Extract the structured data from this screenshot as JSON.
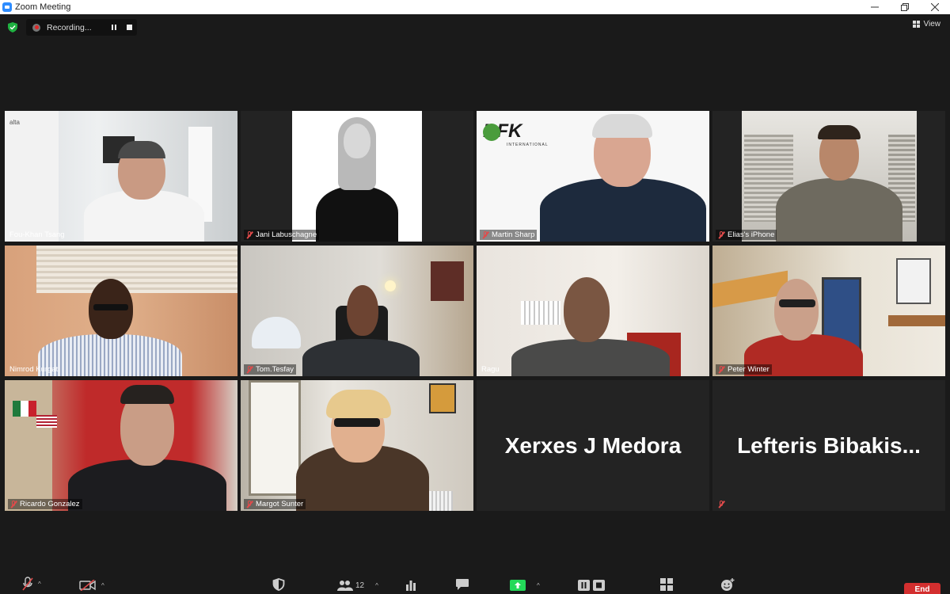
{
  "window": {
    "title": "Zoom Meeting",
    "controls": [
      "minimize",
      "restore",
      "close"
    ]
  },
  "top_bar": {
    "security_icon": "shield-check-icon",
    "recording_label": "Recording...",
    "view_label": "View"
  },
  "tiles": [
    {
      "name": "Fou-Khan Tsang",
      "muted": false,
      "active": false,
      "video": true
    },
    {
      "name": "Jani Labuschagne",
      "muted": true,
      "active": false,
      "video": true
    },
    {
      "name": "Martin Sharp",
      "muted": true,
      "active": false,
      "video": true,
      "logo_text": "DFK",
      "logo_sub": "INTERNATIONAL"
    },
    {
      "name": "Elias's iPhone",
      "muted": true,
      "active": false,
      "video": true
    },
    {
      "name": "Nimrod Kurgat",
      "muted": false,
      "active": true,
      "video": true
    },
    {
      "name": "Tom.Tesfay",
      "muted": true,
      "active": false,
      "video": true
    },
    {
      "name": "Ragu",
      "muted": false,
      "active": false,
      "video": true
    },
    {
      "name": "Peter Winter",
      "muted": true,
      "active": false,
      "video": true
    },
    {
      "name": "Ricardo Gonzalez",
      "muted": true,
      "active": false,
      "video": true
    },
    {
      "name": "Margot Sunter",
      "muted": true,
      "active": false,
      "video": true
    },
    {
      "name": "Xerxes J Medora",
      "muted": false,
      "active": false,
      "video": false
    },
    {
      "name": "Lefteris  Bibakis...",
      "muted": true,
      "active": false,
      "video": false
    }
  ],
  "toolbar": {
    "participants_count": "12",
    "end_label": "End",
    "items": [
      "mute-icon",
      "stop-video-icon",
      "security-icon",
      "participants-icon",
      "polls-icon",
      "chat-icon",
      "share-screen-icon",
      "record-icon",
      "breakout-rooms-icon",
      "reactions-icon"
    ]
  },
  "colors": {
    "active_speaker": "#d5e35a",
    "end_button": "#d32f2f",
    "share_green": "#23d959",
    "muted_red": "#e04b4b"
  }
}
